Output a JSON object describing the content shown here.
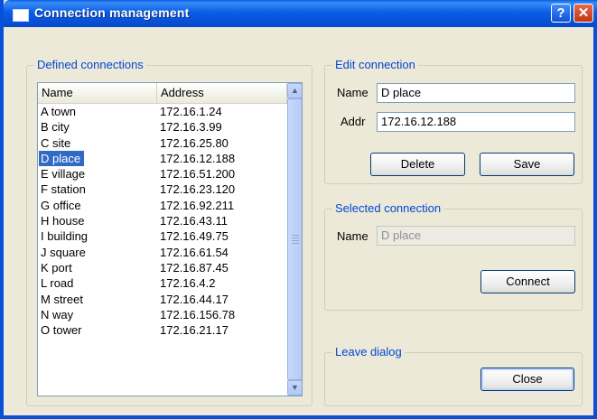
{
  "window": {
    "title": "Connection management"
  },
  "defined": {
    "title": "Defined connections",
    "columns": {
      "name": "Name",
      "address": "Address"
    },
    "selected_index": 3,
    "rows": [
      {
        "name": "A town",
        "address": "172.16.1.24"
      },
      {
        "name": "B city",
        "address": "172.16.3.99"
      },
      {
        "name": "C site",
        "address": "172.16.25.80"
      },
      {
        "name": "D place",
        "address": "172.16.12.188"
      },
      {
        "name": "E village",
        "address": "172.16.51.200"
      },
      {
        "name": "F station",
        "address": "172.16.23.120"
      },
      {
        "name": "G office",
        "address": "172.16.92.211"
      },
      {
        "name": "H house",
        "address": "172.16.43.11"
      },
      {
        "name": "I building",
        "address": "172.16.49.75"
      },
      {
        "name": "J square",
        "address": "172.16.61.54"
      },
      {
        "name": "K port",
        "address": "172.16.87.45"
      },
      {
        "name": "L road",
        "address": "172.16.4.2"
      },
      {
        "name": "M street",
        "address": "172.16.44.17"
      },
      {
        "name": "N way",
        "address": "172.16.156.78"
      },
      {
        "name": "O tower",
        "address": "172.16.21.17"
      }
    ]
  },
  "edit": {
    "title": "Edit connection",
    "name_label": "Name",
    "name_value": "D place",
    "addr_label": "Addr",
    "addr_value": "172.16.12.188",
    "delete_label": "Delete",
    "save_label": "Save"
  },
  "selected": {
    "title": "Selected connection",
    "name_label": "Name",
    "name_value": "D place",
    "connect_label": "Connect"
  },
  "leave": {
    "title": "Leave dialog",
    "close_label": "Close"
  }
}
